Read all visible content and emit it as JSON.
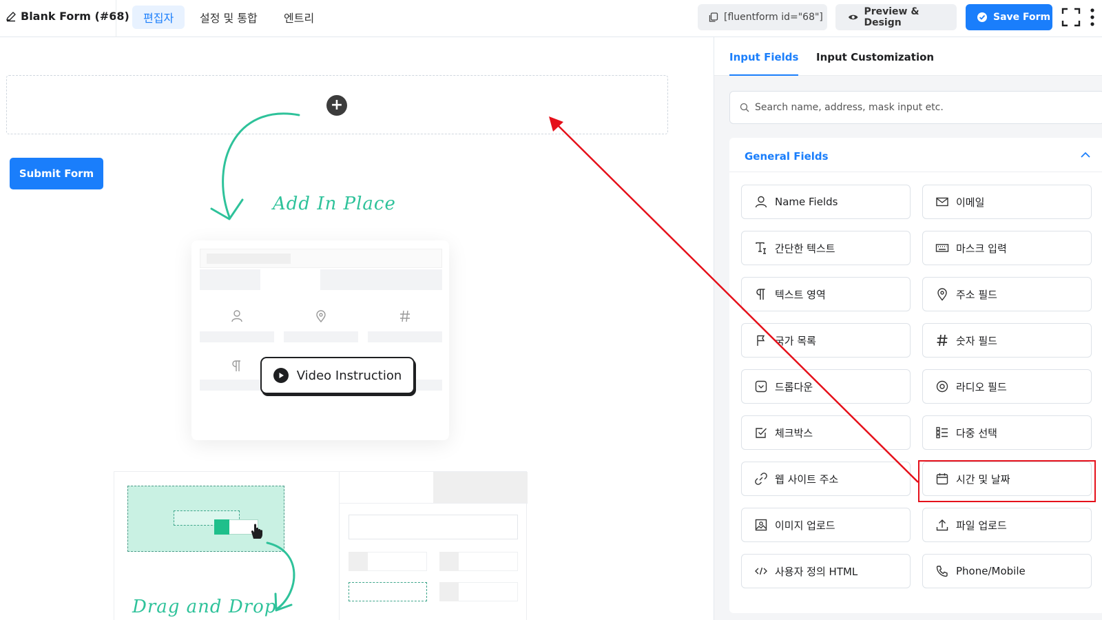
{
  "header": {
    "form_title": "Blank Form (#68)",
    "tabs": [
      {
        "label": "편집자",
        "active": true
      },
      {
        "label": "설정 및 통합",
        "active": false
      },
      {
        "label": "엔트리",
        "active": false
      }
    ],
    "shortcode": "[fluentform id=\"68\"]",
    "preview_label": "Preview & Design",
    "save_label": "Save Form"
  },
  "editor": {
    "submit_label": "Submit Form",
    "add_in_place_label": "Add In Place",
    "video_instruction_label": "Video Instruction",
    "drag_drop_label": "Drag and Drop"
  },
  "panel": {
    "tabs": [
      {
        "label": "Input Fields",
        "active": true
      },
      {
        "label": "Input Customization",
        "active": false
      }
    ],
    "search_placeholder": "Search name, address, mask input etc.",
    "section_title": "General Fields",
    "fields": [
      {
        "label": "Name Fields",
        "icon": "user-icon"
      },
      {
        "label": "이메일",
        "icon": "envelope-icon"
      },
      {
        "label": "간단한 텍스트",
        "icon": "text-cursor-icon"
      },
      {
        "label": "마스크 입력",
        "icon": "keyboard-icon"
      },
      {
        "label": "텍스트 영역",
        "icon": "paragraph-icon"
      },
      {
        "label": "주소 필드",
        "icon": "location-pin-icon"
      },
      {
        "label": "국가 목록",
        "icon": "flag-icon"
      },
      {
        "label": "숫자 필드",
        "icon": "hash-icon"
      },
      {
        "label": "드롭다운",
        "icon": "dropdown-icon"
      },
      {
        "label": "라디오 필드",
        "icon": "radio-icon"
      },
      {
        "label": "체크박스",
        "icon": "checkbox-icon"
      },
      {
        "label": "다중 선택",
        "icon": "list-icon"
      },
      {
        "label": "웹 사이트 주소",
        "icon": "link-icon"
      },
      {
        "label": "시간 및 날짜",
        "icon": "calendar-icon"
      },
      {
        "label": "이미지 업로드",
        "icon": "image-icon"
      },
      {
        "label": "파일 업로드",
        "icon": "upload-icon"
      },
      {
        "label": "사용자 정의 HTML",
        "icon": "code-icon"
      },
      {
        "label": "Phone/Mobile",
        "icon": "phone-icon"
      }
    ]
  },
  "colors": {
    "accent": "#1a7efb",
    "annotation_red": "#e5101a",
    "hand_green": "#2ec29a"
  }
}
